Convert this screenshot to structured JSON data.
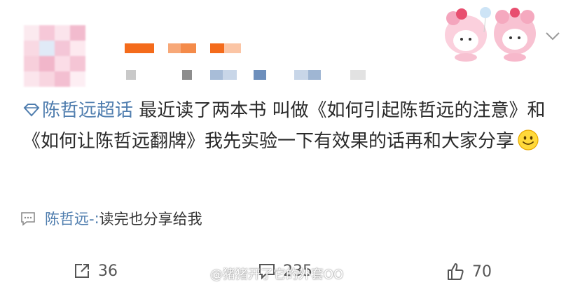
{
  "post": {
    "topic": "陈哲远超话",
    "text": " 最近读了两本书 叫做《如何引起陈哲远的注意》和《如何让陈哲远翻牌》我先实验一下有效果的话再和大家分享"
  },
  "comment": {
    "username": "陈哲远-",
    "separator": ": ",
    "text": "读完也分享给我"
  },
  "actions": {
    "repost_count": "36",
    "comment_count": "235",
    "like_count": "70"
  },
  "watermark": "@猪猪开了它的外套OO",
  "colors": {
    "link": "#4f7dae",
    "text": "#2a2a2a",
    "orange": "#ff6a00"
  },
  "icons": [
    "topic-diamond-icon",
    "smile-emoji-icon",
    "comment-bubble-icon",
    "repost-icon",
    "comment-icon",
    "like-icon",
    "chevron-down-icon"
  ]
}
